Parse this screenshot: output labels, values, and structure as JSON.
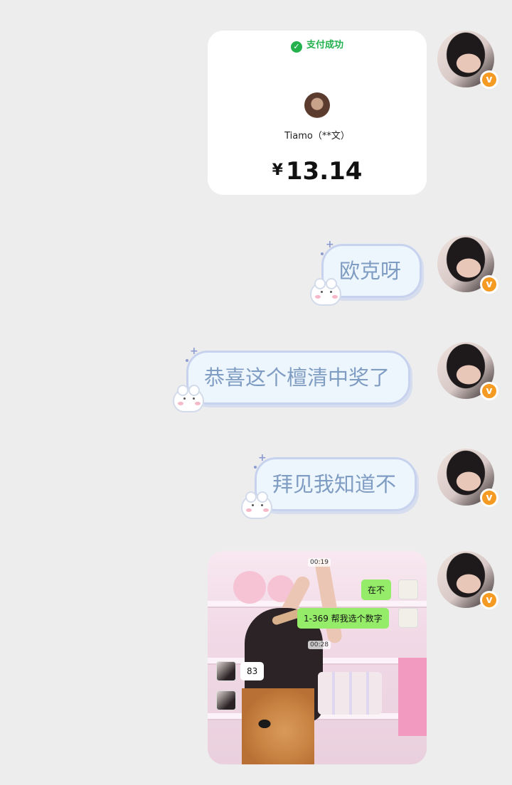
{
  "payment": {
    "status": "支付成功",
    "payee": "Tiamo（**文）",
    "currency": "¥",
    "amount": "13.14"
  },
  "messages": [
    {
      "text": "欧克呀"
    },
    {
      "text": "恭喜这个檀清中奖了"
    },
    {
      "text": "拜见我知道不"
    }
  ],
  "image_message": {
    "time_1": "00:19",
    "time_2": "00:28",
    "bubble_1": "在不",
    "bubble_2": "1-369 帮我选个数字",
    "reply": "83"
  },
  "colors": {
    "background": "#ededed",
    "pay_green": "#22b14c",
    "bubble_text": "#7f9cc2",
    "badge": "#f59a23"
  }
}
